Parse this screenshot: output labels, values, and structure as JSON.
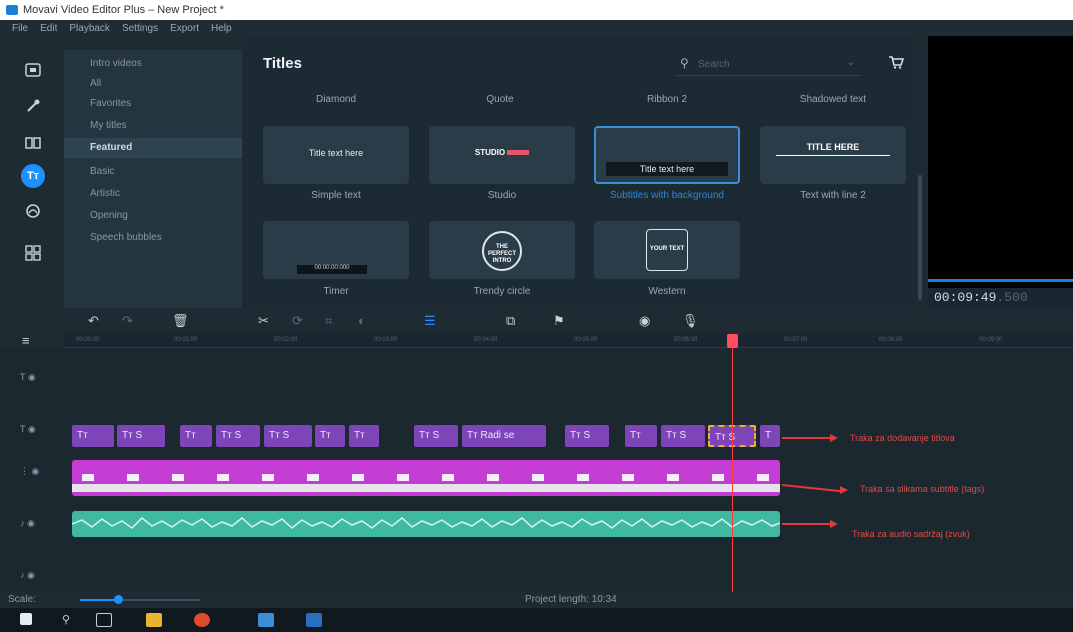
{
  "window": {
    "title": "Movavi Video Editor Plus – New Project *"
  },
  "menu": [
    "File",
    "Edit",
    "Playback",
    "Settings",
    "Export",
    "Help"
  ],
  "rail": {
    "icons": [
      "import-icon",
      "magic-wand-icon",
      "transitions-icon",
      "titles-icon",
      "stickers-icon",
      "more-tools-icon"
    ],
    "active_label": "Tт"
  },
  "categories": {
    "items": [
      "Intro videos",
      "All",
      "Favorites",
      "My titles",
      "Basic",
      "Artistic",
      "Opening",
      "Speech bubbles"
    ],
    "selected": "Featured"
  },
  "panel": {
    "title": "Titles",
    "search_placeholder": "Search",
    "top_row_labels": [
      "Diamond",
      "Quote",
      "Ribbon 2",
      "Shadowed text"
    ],
    "cards": [
      {
        "thumb_text": "Title text here",
        "label": "Simple text"
      },
      {
        "thumb_text": "STUDIO",
        "label": "Studio"
      },
      {
        "thumb_text": "Title text here",
        "label": "Subtitles with background"
      },
      {
        "thumb_text": "TITLE HERE",
        "label": "Text with line 2"
      },
      {
        "thumb_text": "00:00:00:000",
        "label": "Timer"
      },
      {
        "thumb_text": "THE PERFECT INTRO",
        "label": "Trendy circle"
      },
      {
        "thumb_text": "YOUR TEXT",
        "label": "Western"
      }
    ]
  },
  "preview": {
    "timecode": "00:09:49",
    "timecode_ms": ".500"
  },
  "timeline": {
    "title_clips": [
      "Tт",
      "Tт S",
      "Tт",
      "Tт S",
      "Tт S",
      "Tт",
      "Tт",
      "Tт S",
      "Tт Radi se",
      "Tт S",
      "Tт",
      "Tт S",
      "Tт S",
      "T"
    ],
    "annotations": [
      "Traka za dodavanje titlova",
      "Traka sa slikama subtitle (tags)",
      "Traka za audio sadržaj (zvuk)"
    ]
  },
  "status": {
    "scale_label": "Scale:",
    "project_length": "Project length: 10:34"
  },
  "colors": {
    "accent": "#1e90ff",
    "title_clip": "#7d45b7",
    "subtitle_clip": "#c53cd5",
    "audio_clip": "#3fb9a2",
    "playhead": "#ff3b3b"
  }
}
